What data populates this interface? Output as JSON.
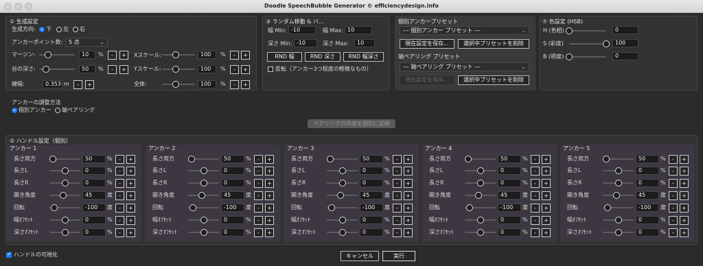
{
  "window": {
    "title": "Doodle SpeechBubble Generator © efficiencydesign.info"
  },
  "s1": {
    "title": "① 生成設定",
    "dir_label": "生成方向:",
    "dir_options": [
      "下",
      "左",
      "右"
    ],
    "dir_selected": 0,
    "anchor_count_label": "アンカーポイント数:",
    "anchor_count_value": "5 点",
    "margin_label": "マージン:",
    "margin_value": "10",
    "margin_level": 0.25,
    "depth_label": "谷の深さ:",
    "depth_value": "50",
    "depth_level": 0.2,
    "width_label": "線幅:",
    "width_value": "0.353",
    "width_unit": "m",
    "xscale_label": "Xスケール:",
    "xscale_value": "100",
    "xscale_level": 0.42,
    "yscale_label": "Yスケール:",
    "yscale_value": "100",
    "yscale_level": 0.42,
    "all_label": "全体:",
    "all_value": "100",
    "all_level": 0.42,
    "percent": "%",
    "minus": "-",
    "plus": "+"
  },
  "s3": {
    "title": "③ ランダム移動 & バ...",
    "wmin_label": "幅 Min:",
    "wmin_value": "-10",
    "wmax_label": "幅 Max:",
    "wmax_value": "10",
    "dmin_label": "深さ Min:",
    "dmin_value": "-10",
    "dmax_label": "深さ Max:",
    "dmax_value": "10",
    "btn_rnd_w": "RND 幅",
    "btn_rnd_d": "RND 深さ",
    "btn_rnd_wd": "RND 幅深さ",
    "flip_label": "反転（アンカー3つ程度の軽微なもの）",
    "flip_checked": false
  },
  "presets": {
    "individual_title": "個別アンカープリセット",
    "individual_select": "--- 個別アンカー プリセット ---",
    "save_label": "現在設定を保存...",
    "delete_label": "選択中プリセットを削除",
    "pair_title": "端ペアリング プリセット",
    "pair_select": "--- 端ペアリング プリセット ---",
    "pair_save_label": "現在設定を保存...",
    "pair_delete_label": "選択中プリセットを削除"
  },
  "s7": {
    "title": "⑦ 色設定 (HSB)",
    "h_label": "H (色相)",
    "h_value": "0",
    "h_level": 0.0,
    "s_label": "S (彩度)",
    "s_value": "100",
    "s_level": 1.0,
    "b_label": "B (明度)",
    "b_value": "0",
    "b_level": 0.0
  },
  "adjust": {
    "title": "アンカーの調整方法",
    "options": [
      "個別アンカー",
      "端ペアリング"
    ],
    "selected": 0,
    "apply_pair_label": "ペアリングの内容を個別に反映"
  },
  "s2": {
    "title": "② ハンドル設定（個別）",
    "row_labels": [
      "長さ両方",
      "長さL",
      "長さR",
      "開き角度",
      "回転",
      "幅ｵﾌｾｯﾄ",
      "深さｵﾌｾｯﾄ"
    ],
    "units": [
      "%",
      "%",
      "%",
      "度",
      "度",
      "%",
      "%"
    ],
    "levels": [
      0.5,
      0.5,
      0.5,
      0.62,
      0.5,
      0.5,
      0.5
    ],
    "anchors": [
      {
        "name": "アンカー 1",
        "values": [
          "50",
          "0",
          "0",
          "45",
          "-100",
          "0",
          "0"
        ],
        "levels": [
          0.12,
          0.5,
          0.5,
          0.45,
          0.15,
          0.5,
          0.5
        ]
      },
      {
        "name": "アンカー 2",
        "values": [
          "50",
          "0",
          "0",
          "45",
          "-100",
          "0",
          "0"
        ],
        "levels": [
          0.12,
          0.5,
          0.5,
          0.45,
          0.15,
          0.5,
          0.5
        ]
      },
      {
        "name": "アンカー 3",
        "values": [
          "50",
          "0",
          "0",
          "45",
          "-100",
          "0",
          "0"
        ],
        "levels": [
          0.12,
          0.5,
          0.5,
          0.45,
          0.15,
          0.5,
          0.5
        ]
      },
      {
        "name": "アンカー 4",
        "values": [
          "50",
          "0",
          "0",
          "45",
          "-100",
          "0",
          "0"
        ],
        "levels": [
          0.12,
          0.5,
          0.5,
          0.45,
          0.15,
          0.5,
          0.5
        ]
      },
      {
        "name": "アンカー 5",
        "values": [
          "50",
          "0",
          "0",
          "45",
          "-100",
          "0",
          "0"
        ],
        "levels": [
          0.12,
          0.5,
          0.5,
          0.45,
          0.15,
          0.5,
          0.5
        ]
      }
    ]
  },
  "footer": {
    "show_handles_label": "ハンドルの可視化",
    "show_handles_checked": true,
    "cancel_label": "キャンセル",
    "run_label": "実行"
  }
}
